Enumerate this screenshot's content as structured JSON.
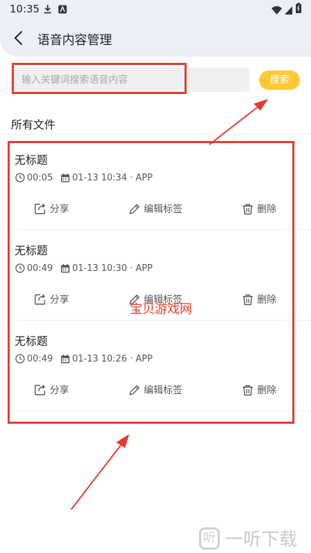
{
  "status_bar": {
    "time": "10:35"
  },
  "header": {
    "title": "语音内容管理"
  },
  "search": {
    "placeholder": "输入关键词搜索语音内容",
    "button_label": "搜索"
  },
  "section": {
    "title": "所有文件"
  },
  "actions": {
    "share": "分享",
    "edit_tag": "编辑标签",
    "delete": "删除"
  },
  "items": [
    {
      "title": "无标题",
      "duration": "00:05",
      "datetime": "01-13 10:34 · APP"
    },
    {
      "title": "无标题",
      "duration": "00:49",
      "datetime": "01-13 10:30 · APP"
    },
    {
      "title": "无标题",
      "duration": "00:49",
      "datetime": "01-13 10:26 · APP"
    }
  ],
  "watermarks": {
    "center": "宝贝游戏网",
    "corner": "一听下载",
    "corner_logo": "听"
  },
  "colors": {
    "accent": "#ffc935",
    "annotation": "#e23b2e",
    "header_bg": "#eceef8"
  }
}
